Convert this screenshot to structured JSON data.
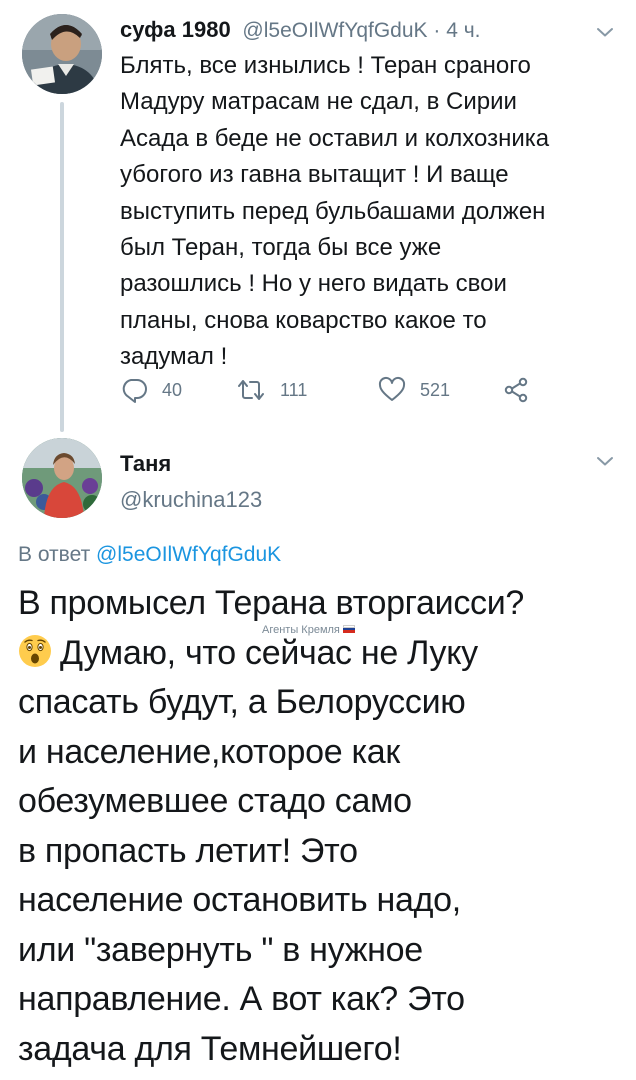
{
  "tweet1": {
    "display_name": "суфа 1980",
    "handle": "@l5eOIlWfYqfGduK",
    "separator": " · ",
    "time": "4 ч.",
    "body": "Блять, все изнылись ! Теран сраного\nМадуру матрасам не сдал, в Сирии\nАсада в беде не оставил и колхозника\nубогого из гавна вытащит ! И ваще\nвыступить перед бульбашами должен\nбыл Теран, тогда бы все уже\nразошлись ! Но у него видать свои\nпланы, снова коварство какое то\nзадумал !",
    "actions": {
      "replies": "40",
      "retweets": "111",
      "likes": "521"
    }
  },
  "tweet2": {
    "display_name": "Таня",
    "handle": "@kruchina123",
    "reply_prefix": "В ответ ",
    "reply_mention": "@l5eOIlWfYqfGduK",
    "body_lines": [
      "В промысел Терана вторгаисси?",
      "Думаю, что сейчас не Луку",
      "спасать будут, а Белоруссию",
      "и население,которое как",
      "обезумевшее стадо само",
      "в пропасть летит! Это",
      "население остановить надо,",
      "или \"завернуть \" в нужное",
      "направление. А вот как? Это",
      "задача для Темнейшего!"
    ],
    "emoji": "astonished-face",
    "watermark": "Агенты Кремля"
  },
  "icons": {
    "reply": "reply-icon",
    "retweet": "retweet-icon",
    "like": "heart-icon",
    "share": "share-icon",
    "chevron": "chevron-down-icon"
  },
  "colors": {
    "text": "#14171a",
    "secondary": "#657786",
    "link": "#1b95e0",
    "thread_line": "#ccd6dd",
    "watermark": "#7b8a96"
  }
}
